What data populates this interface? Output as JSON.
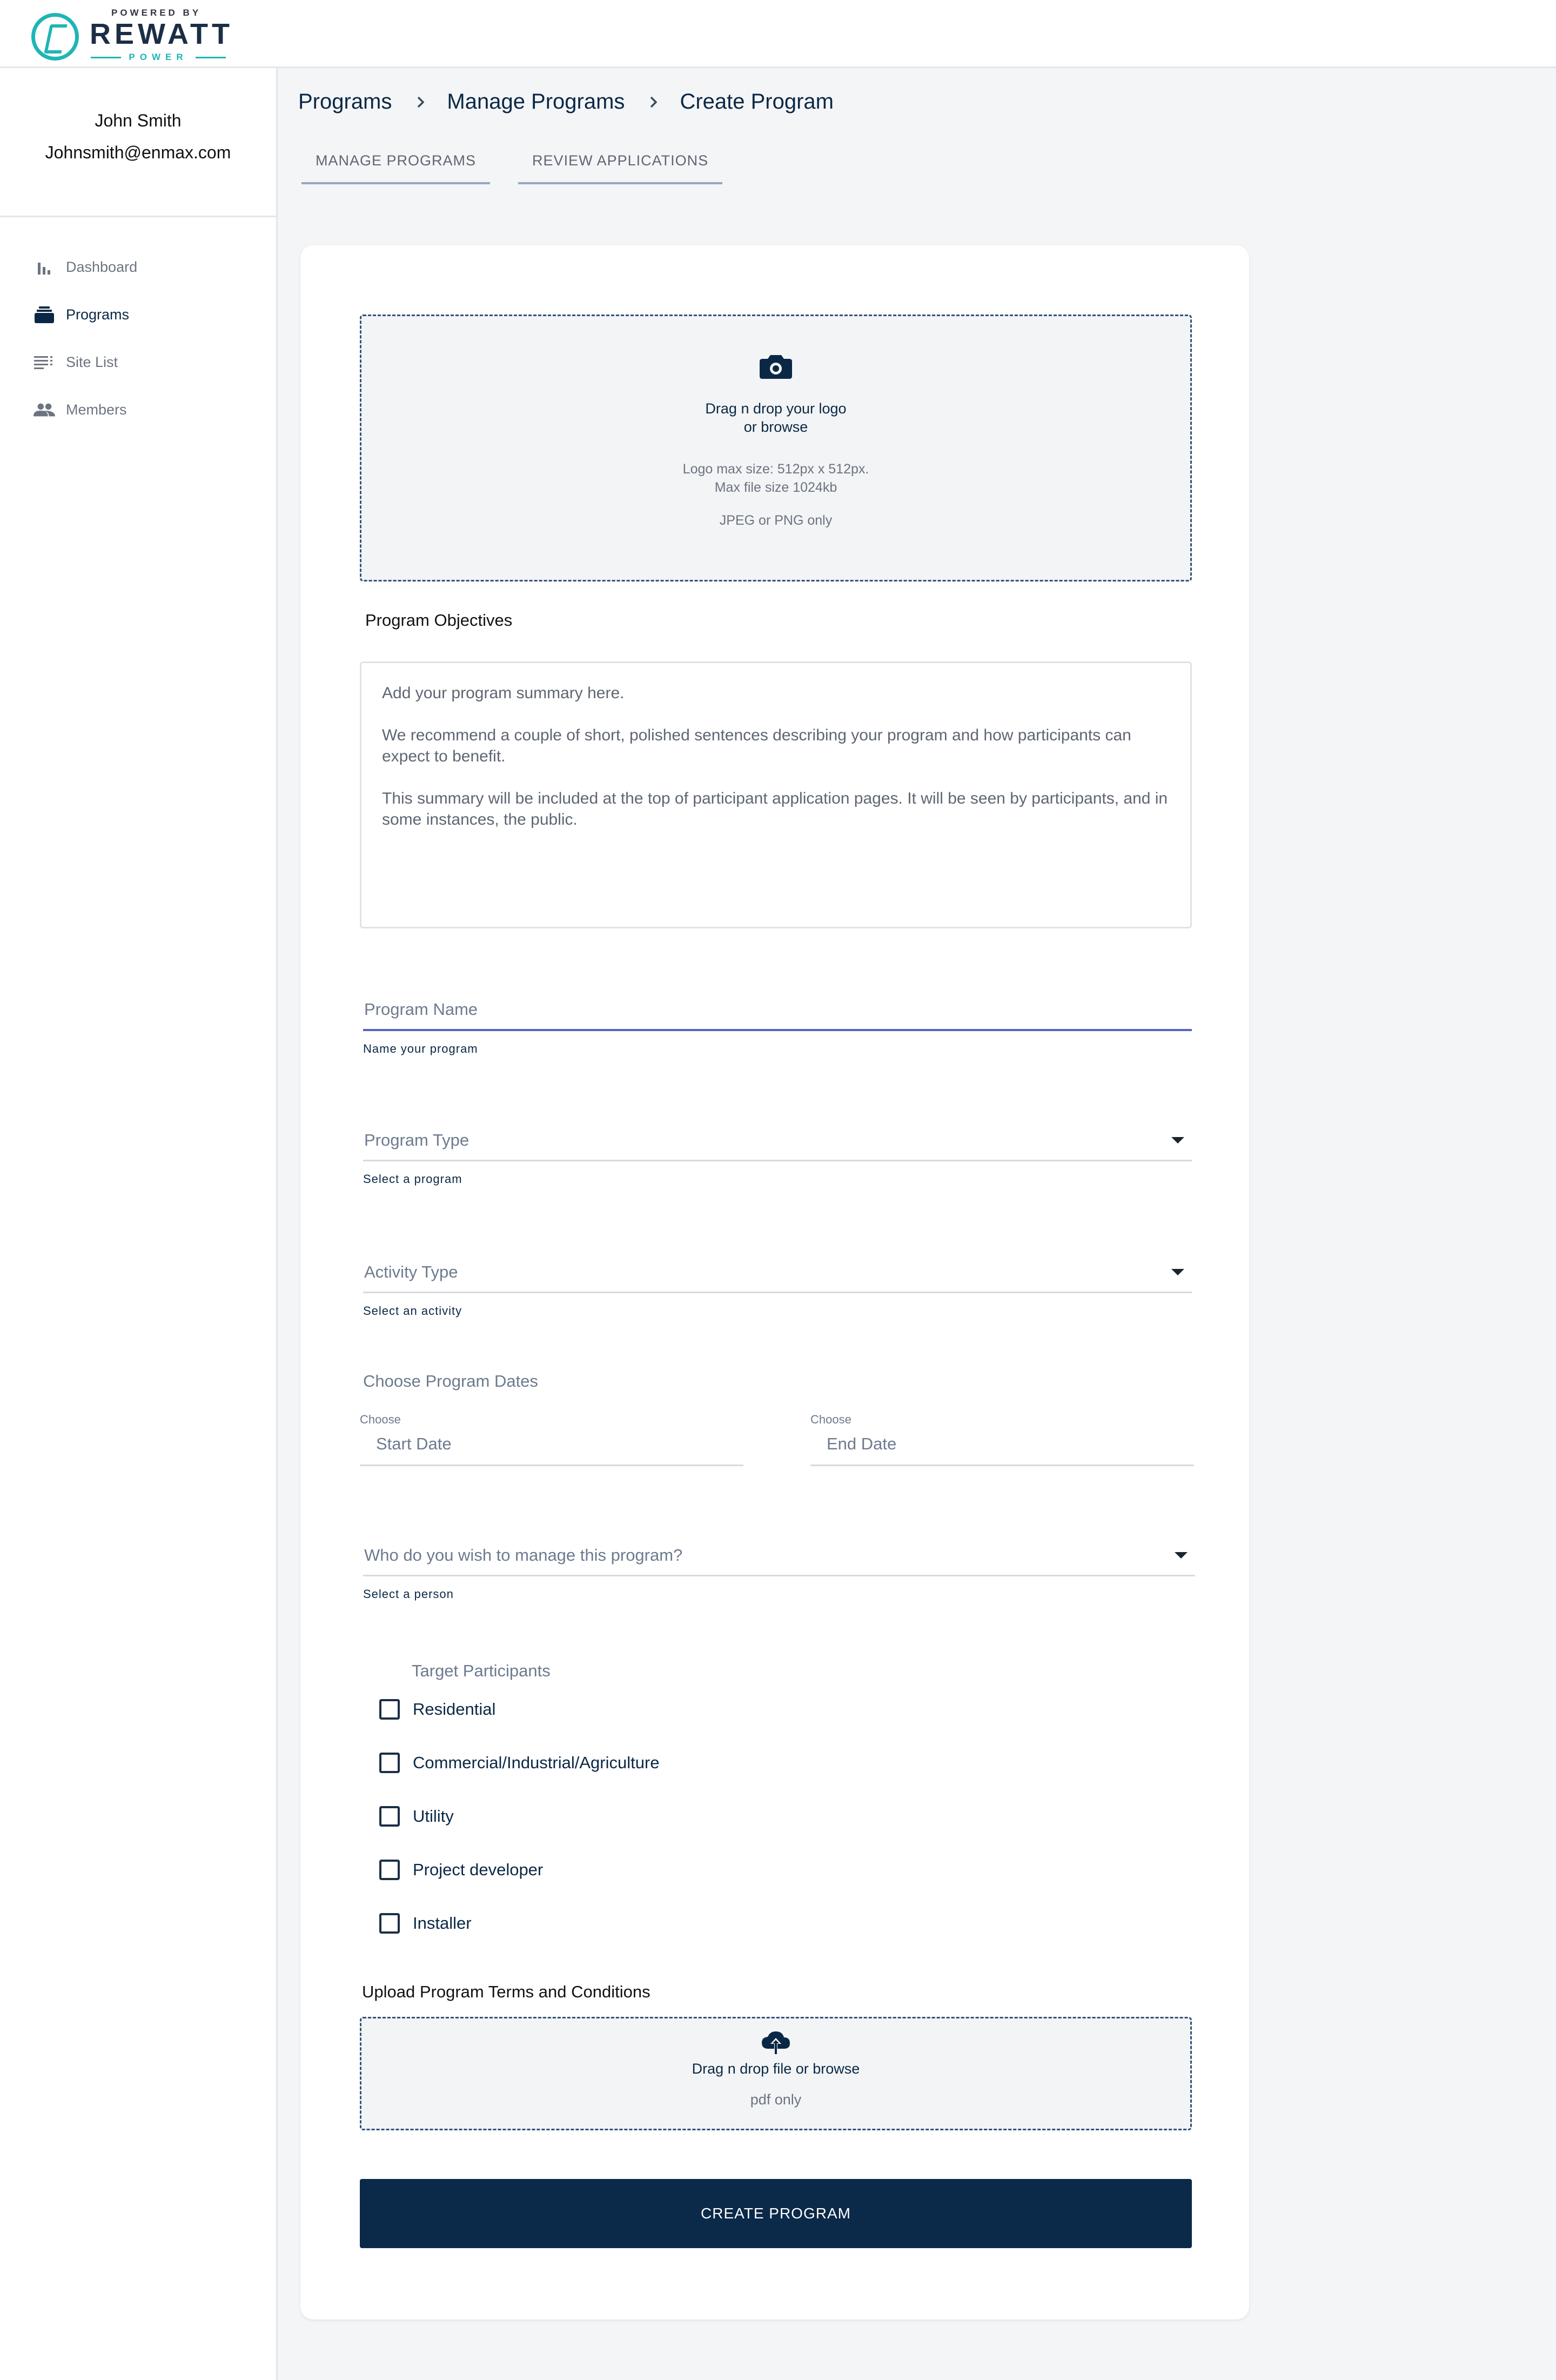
{
  "brand": {
    "powered_by": "POWERED BY",
    "name": "REWATT",
    "sub": "POWER",
    "accent_color": "#1fb5b5"
  },
  "user": {
    "name": "John Smith",
    "email": "Johnsmith@enmax.com"
  },
  "sidebar": {
    "items": [
      {
        "label": "Dashboard",
        "icon": "bar-chart-icon",
        "active": false
      },
      {
        "label": "Programs",
        "icon": "inbox-stack-icon",
        "active": true
      },
      {
        "label": "Site List",
        "icon": "list-icon",
        "active": false
      },
      {
        "label": "Members",
        "icon": "people-icon",
        "active": false
      }
    ]
  },
  "breadcrumb": [
    "Programs",
    "Manage Programs",
    "Create Program"
  ],
  "tabs": [
    "MANAGE PROGRAMS",
    "REVIEW APPLICATIONS"
  ],
  "logo_upload": {
    "icon": "camera-icon",
    "line1": "Drag n drop your logo",
    "line2": "or browse",
    "size_note1": "Logo max size: 512px x 512px.",
    "size_note2": "Max file size 1024kb",
    "format_note": "JPEG or PNG only"
  },
  "objectives": {
    "label": "Program Objectives",
    "paragraphs": [
      "Add your program summary here.",
      "We recommend a couple of short, polished sentences describing your program and how participants can expect to benefit.",
      "This summary will be included at the top of participant application pages. It will be seen by participants, and in some instances, the public."
    ]
  },
  "program_name": {
    "placeholder": "Program Name",
    "hint": "Name your program"
  },
  "program_type": {
    "placeholder": "Program Type",
    "hint": "Select a program"
  },
  "activity_type": {
    "placeholder": "Activity Type",
    "hint": "Select an activity"
  },
  "dates": {
    "label": "Choose Program Dates",
    "start": {
      "small": "Choose",
      "placeholder": "Start Date"
    },
    "end": {
      "small": "Choose",
      "placeholder": "End Date"
    }
  },
  "manager": {
    "placeholder": "Who do you wish to manage this program?",
    "hint": "Select a person"
  },
  "targets": {
    "label": "Target Participants",
    "options": [
      "Residential",
      "Commercial/Industrial/Agriculture",
      "Utility",
      "Project developer",
      "Installer"
    ]
  },
  "terms": {
    "label": "Upload Program Terms and Conditions",
    "icon": "cloud-upload-icon",
    "line1": "Drag n drop file or browse",
    "line2": "pdf only"
  },
  "submit_label": "CREATE PROGRAM"
}
